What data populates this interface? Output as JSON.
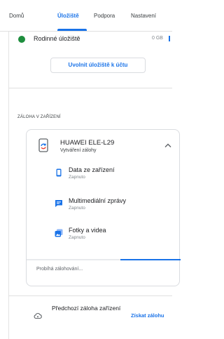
{
  "tabs": [
    {
      "label": "Domů"
    },
    {
      "label": "Úložiště",
      "active": true
    },
    {
      "label": "Podpora"
    },
    {
      "label": "Nastavení"
    }
  ],
  "family_storage": {
    "label": "Rodinné úložiště",
    "size": "0 GB",
    "dot_color": "#1e8e3e"
  },
  "free_storage_button": "Uvolnit úložiště k účtu",
  "section_heading": "ZÁLOHA V ZAŘÍZENÍ",
  "device": {
    "name": "HUAWEI ELE-L29",
    "status": "Vytváření zálohy",
    "icon": "backup-phone-icon",
    "expanded_indicator": "chevron-up-icon"
  },
  "backup_items": [
    {
      "title": "Data ze zařízení",
      "status": "Zapnuto",
      "icon": "phone-icon"
    },
    {
      "title": "Multimediální zprávy",
      "status": "Zapnuto",
      "icon": "message-icon"
    },
    {
      "title": "Fotky a videa",
      "status": "Zapnuto",
      "icon": "photos-icon"
    }
  ],
  "progress": {
    "text": "Probíhá zálohování...",
    "value": 0.39
  },
  "previous_backup": {
    "label": "Předchozí záloha zařízení",
    "action": "Získat zálohu",
    "icon": "cloud-backup-icon"
  },
  "colors": {
    "accent": "#1a73e8",
    "text": "#202124",
    "muted": "#80868b"
  }
}
